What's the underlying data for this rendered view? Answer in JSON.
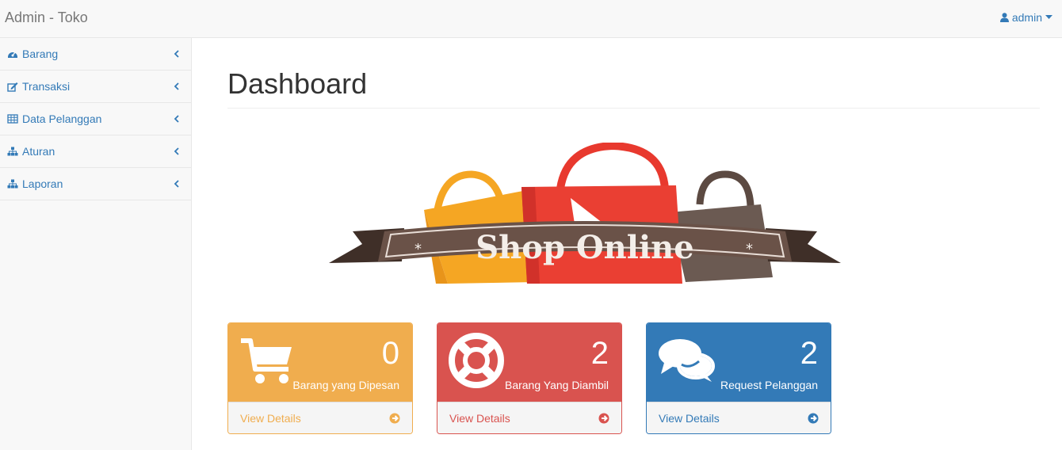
{
  "navbar": {
    "brand": "Admin - Toko",
    "user": {
      "label": "admin",
      "icon": "user-icon",
      "caret_icon": "caret-down-icon"
    }
  },
  "sidebar": {
    "items": [
      {
        "label": "Barang",
        "icon": "dashboard-icon"
      },
      {
        "label": "Transaksi",
        "icon": "edit-icon"
      },
      {
        "label": "Data Pelanggan",
        "icon": "table-icon"
      },
      {
        "label": "Aturan",
        "icon": "sitemap-icon"
      },
      {
        "label": "Laporan",
        "icon": "sitemap-icon"
      }
    ]
  },
  "main": {
    "title": "Dashboard",
    "logo_text": "Shop Online",
    "panels": [
      {
        "value": "0",
        "caption": "Barang yang Dipesan",
        "link": "View Details",
        "icon": "shopping-cart-icon",
        "color": "#f0ad4e"
      },
      {
        "value": "2",
        "caption": "Barang Yang Diambil",
        "link": "View Details",
        "icon": "life-ring-icon",
        "color": "#d9534f"
      },
      {
        "value": "2",
        "caption": "Request Pelanggan",
        "link": "View Details",
        "icon": "comments-icon",
        "color": "#337ab7"
      }
    ]
  },
  "colors": {
    "link": "#337ab7",
    "navbar_bg": "#f8f8f8",
    "border": "#e7e7e7"
  }
}
